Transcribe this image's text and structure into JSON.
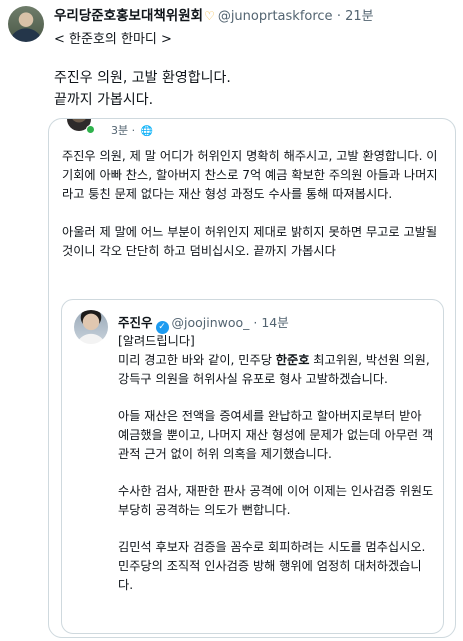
{
  "post": {
    "display_name": "우리당준호홍보대책위원회",
    "handle": "@junoprtaskforce",
    "time": "· 21분",
    "subtitle": "< 한준호의 한마디 >",
    "lines": [
      "주진우 의원, 고발 환영합니다.",
      "끝까지 가봅시다."
    ]
  },
  "quote": {
    "time": "3분 ·",
    "globe": "🌐",
    "paragraphs": [
      "주진우 의원, 제 말 어디가 허위인지 명확히 해주시고, 고발 환영합니다. 이 기회에 아빠 찬스, 할아버지 찬스로 7억 예금 확보한 주의원 아들과 나머지라고 퉁친 문제 없다는 재산 형성 과정도 수사를 통해 따져봅시다.",
      "아울러 제 말에 어느 부분이 허위인지 제대로 밝히지 못하면 무고로 고발될 것이니 각오 단단히 하고 덤비십시오. 끝까지 가봅시다"
    ]
  },
  "inner": {
    "name": "주진우",
    "handle": "@joojinwoo_",
    "time": "· 14분",
    "notice": "[알려드립니다]",
    "p1_before": "미리 경고한 바와 같이, 민주당 ",
    "p1_bold": "한준호",
    "p1_after": " 최고위원, 박선원 의원, 강득구 의원을 허위사실 유포로 형사 고발하겠습니다.",
    "p2": "아들 재산은 전액을 증여세를 완납하고 할아버지로부터 받아 예금했을 뿐이고, 나머지 재산 형성에 문제가 없는데 아무런 객관적 근거 없이 허위 의혹을 제기했습니다.",
    "p3": "수사한 검사, 재판한 판사 공격에 이어 이제는 인사검증 위원도 부당히 공격하는 의도가 뻔합니다.",
    "p4": "김민석 후보자 검증을 꼼수로 회피하려는 시도를 멈추십시오. 민주당의 조직적 인사검증 방해 행위에 엄정히 대처하겠습니다."
  }
}
